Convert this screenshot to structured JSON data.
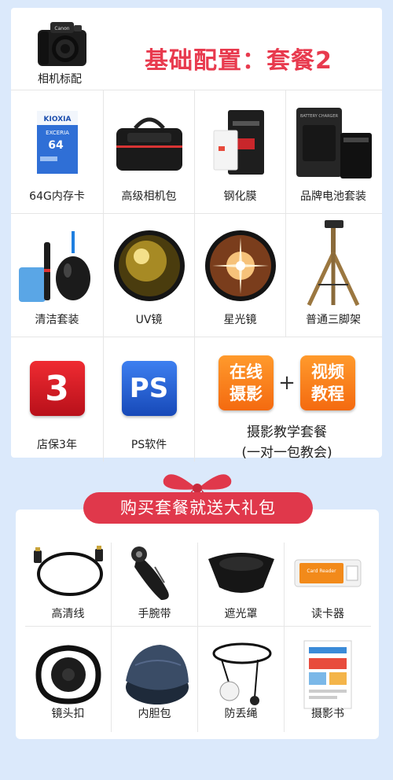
{
  "header": {
    "camera_label": "相机标配",
    "title": "基础配置：套餐2"
  },
  "items": [
    {
      "label": "64G内存卡",
      "icon": "sd-card-icon",
      "card_brand": "KIOXIA",
      "card_series": "EXCERIA",
      "card_capacity": "64"
    },
    {
      "label": "高级相机包",
      "icon": "camera-bag-icon"
    },
    {
      "label": "钢化膜",
      "icon": "screen-protector-icon"
    },
    {
      "label": "品牌电池套装",
      "icon": "battery-charger-icon",
      "charger_text": "BATTERY CHARGER"
    },
    {
      "label": "清洁套装",
      "icon": "cleaning-kit-icon"
    },
    {
      "label": "UV镜",
      "icon": "uv-filter-icon"
    },
    {
      "label": "星光镜",
      "icon": "star-filter-icon"
    },
    {
      "label": "普通三脚架",
      "icon": "tripod-icon"
    },
    {
      "label": "店保3年",
      "icon": "warranty-icon",
      "tile_text": "3"
    },
    {
      "label": "PS软件",
      "icon": "ps-software-icon",
      "tile_text": "PS"
    }
  ],
  "education": {
    "tile1": [
      "在线",
      "摄影"
    ],
    "tile2": [
      "视频",
      "教程"
    ],
    "plus": "+",
    "line1": "摄影教学套餐",
    "line2": "(一对一包教会)"
  },
  "gifts": {
    "banner": "购买套餐就送大礼包",
    "items": [
      {
        "label": "高清线",
        "icon": "hdmi-cable-icon"
      },
      {
        "label": "手腕带",
        "icon": "wrist-strap-icon"
      },
      {
        "label": "遮光罩",
        "icon": "lens-hood-icon"
      },
      {
        "label": "读卡器",
        "icon": "card-reader-icon",
        "reader_text": "Card Reader"
      },
      {
        "label": "镜头扣",
        "icon": "lens-cap-holder-icon"
      },
      {
        "label": "内胆包",
        "icon": "lens-pouch-icon"
      },
      {
        "label": "防丢绳",
        "icon": "anti-lost-rope-icon"
      },
      {
        "label": "摄影书",
        "icon": "photo-book-icon"
      }
    ]
  },
  "colors": {
    "page_bg": "#dbe9fb",
    "title_red": "#e83a4e",
    "banner_red": "#e0384b",
    "tile_orange": "#f46a10",
    "tile_red": "#d51a22",
    "tile_blue": "#2b63d8"
  }
}
